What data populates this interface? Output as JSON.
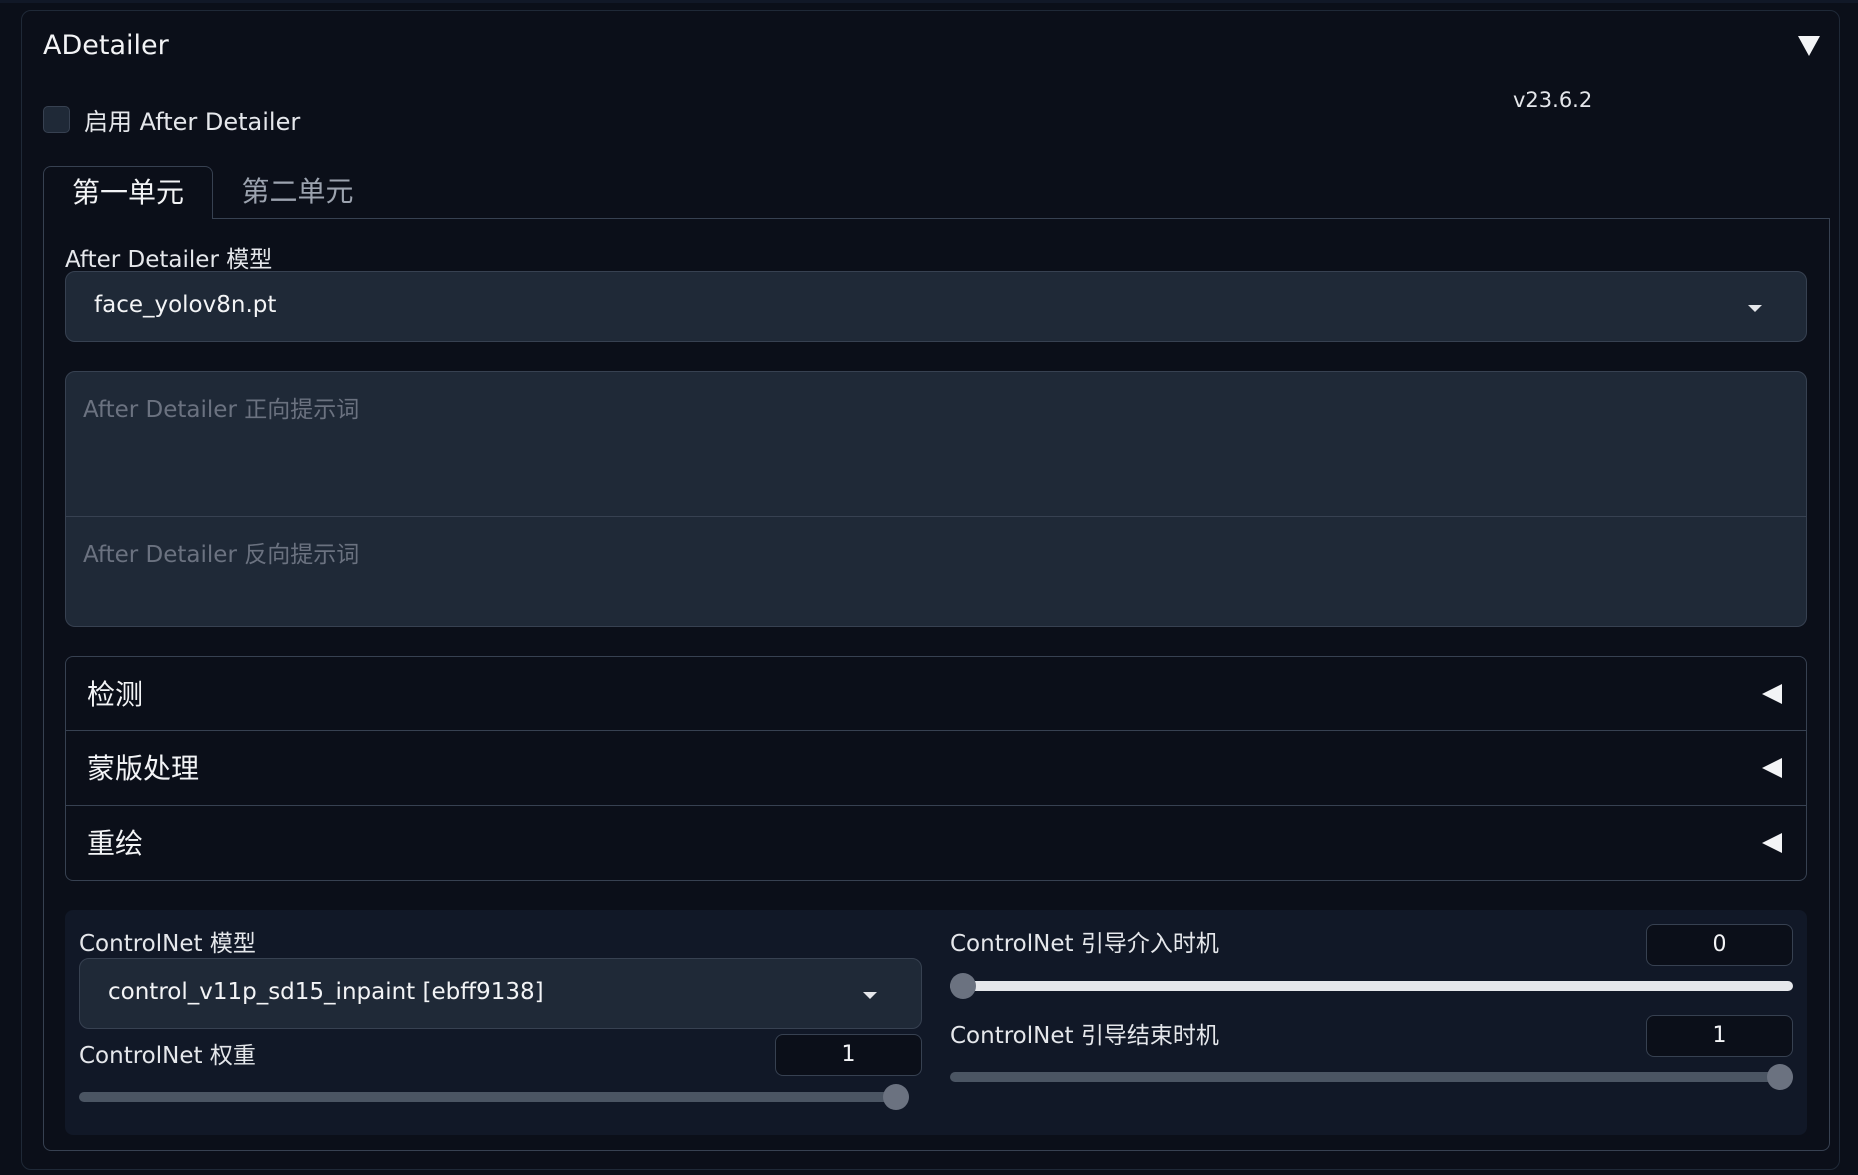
{
  "panel": {
    "title": "ADetailer",
    "version": "v23.6.2"
  },
  "enable": {
    "label": "启用 After Detailer",
    "checked": false
  },
  "tabs": [
    {
      "label": "第一单元",
      "active": true
    },
    {
      "label": "第二单元",
      "active": false
    }
  ],
  "model": {
    "label": "After Detailer 模型",
    "value": "face_yolov8n.pt"
  },
  "prompts": {
    "positive_placeholder": "After Detailer 正向提示词",
    "negative_placeholder": "After Detailer 反向提示词"
  },
  "accordions": [
    {
      "label": "检测"
    },
    {
      "label": "蒙版处理"
    },
    {
      "label": "重绘"
    }
  ],
  "controlnet": {
    "model_label": "ControlNet 模型",
    "model_value": "control_v11p_sd15_inpaint [ebff9138]",
    "weight_label": "ControlNet 权重",
    "weight_value": "1",
    "weight_fraction": 1.0,
    "guidance_start_label": "ControlNet 引导介入时机",
    "guidance_start_value": "0",
    "guidance_start_fraction": 0.0,
    "guidance_end_label": "ControlNet 引导结束时机",
    "guidance_end_value": "1",
    "guidance_end_fraction": 1.0
  },
  "colors": {
    "background": "#0b0f19",
    "input": "#1f2937",
    "border": "#374151",
    "slider_fill": "#e5e7eb",
    "slider_track": "#4b5563"
  }
}
